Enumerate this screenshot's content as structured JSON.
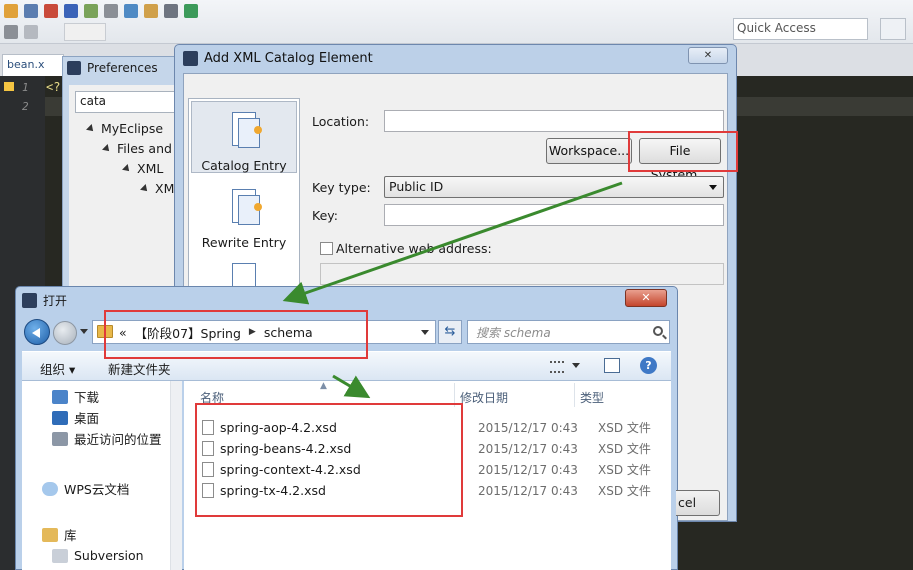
{
  "ide": {
    "quick_access_placeholder": "Quick Access",
    "editor_tab": "bean.x",
    "editor_lines": [
      "1",
      "2"
    ],
    "code_line1": "<?"
  },
  "preferences": {
    "title": "Preferences",
    "filter_value": "cata",
    "tree": [
      "MyEclipse",
      "Files and",
      "XML",
      "XM"
    ]
  },
  "xml_dialog": {
    "title": "Add XML Catalog Element",
    "close_label": "✕",
    "entries": [
      "Catalog Entry",
      "Rewrite Entry"
    ],
    "location_label": "Location:",
    "location_value": "",
    "workspace_button": "Workspace...",
    "filesystem_button": "File System...",
    "key_type_label": "Key type:",
    "key_type_value": "Public ID",
    "key_label": "Key:",
    "key_value": "",
    "alt_web_label": "Alternative web address:"
  },
  "open_dialog": {
    "title": "打开",
    "close_label": "✕",
    "path_prefix": "«",
    "path": [
      "【阶段07】Spring",
      "schema"
    ],
    "search_placeholder": "搜索 schema",
    "organize_label": "组织 ▾",
    "new_folder_label": "新建文件夹",
    "nav_items": [
      "下载",
      "桌面",
      "最近访问的位置",
      "WPS云文档",
      "库",
      "Subversion"
    ],
    "columns": {
      "name": "名称",
      "modified": "修改日期",
      "type": "类型"
    },
    "files": [
      {
        "name": "spring-aop-4.2.xsd",
        "date": "2015/12/17 0:43",
        "type": "XSD 文件"
      },
      {
        "name": "spring-beans-4.2.xsd",
        "date": "2015/12/17 0:43",
        "type": "XSD 文件"
      },
      {
        "name": "spring-context-4.2.xsd",
        "date": "2015/12/17 0:43",
        "type": "XSD 文件"
      },
      {
        "name": "spring-tx-4.2.xsd",
        "date": "2015/12/17 0:43",
        "type": "XSD 文件"
      }
    ],
    "cancel_partial": "cel"
  },
  "colors": {
    "annotation": "#e03a3a",
    "arrow": "#3a8a2e"
  }
}
